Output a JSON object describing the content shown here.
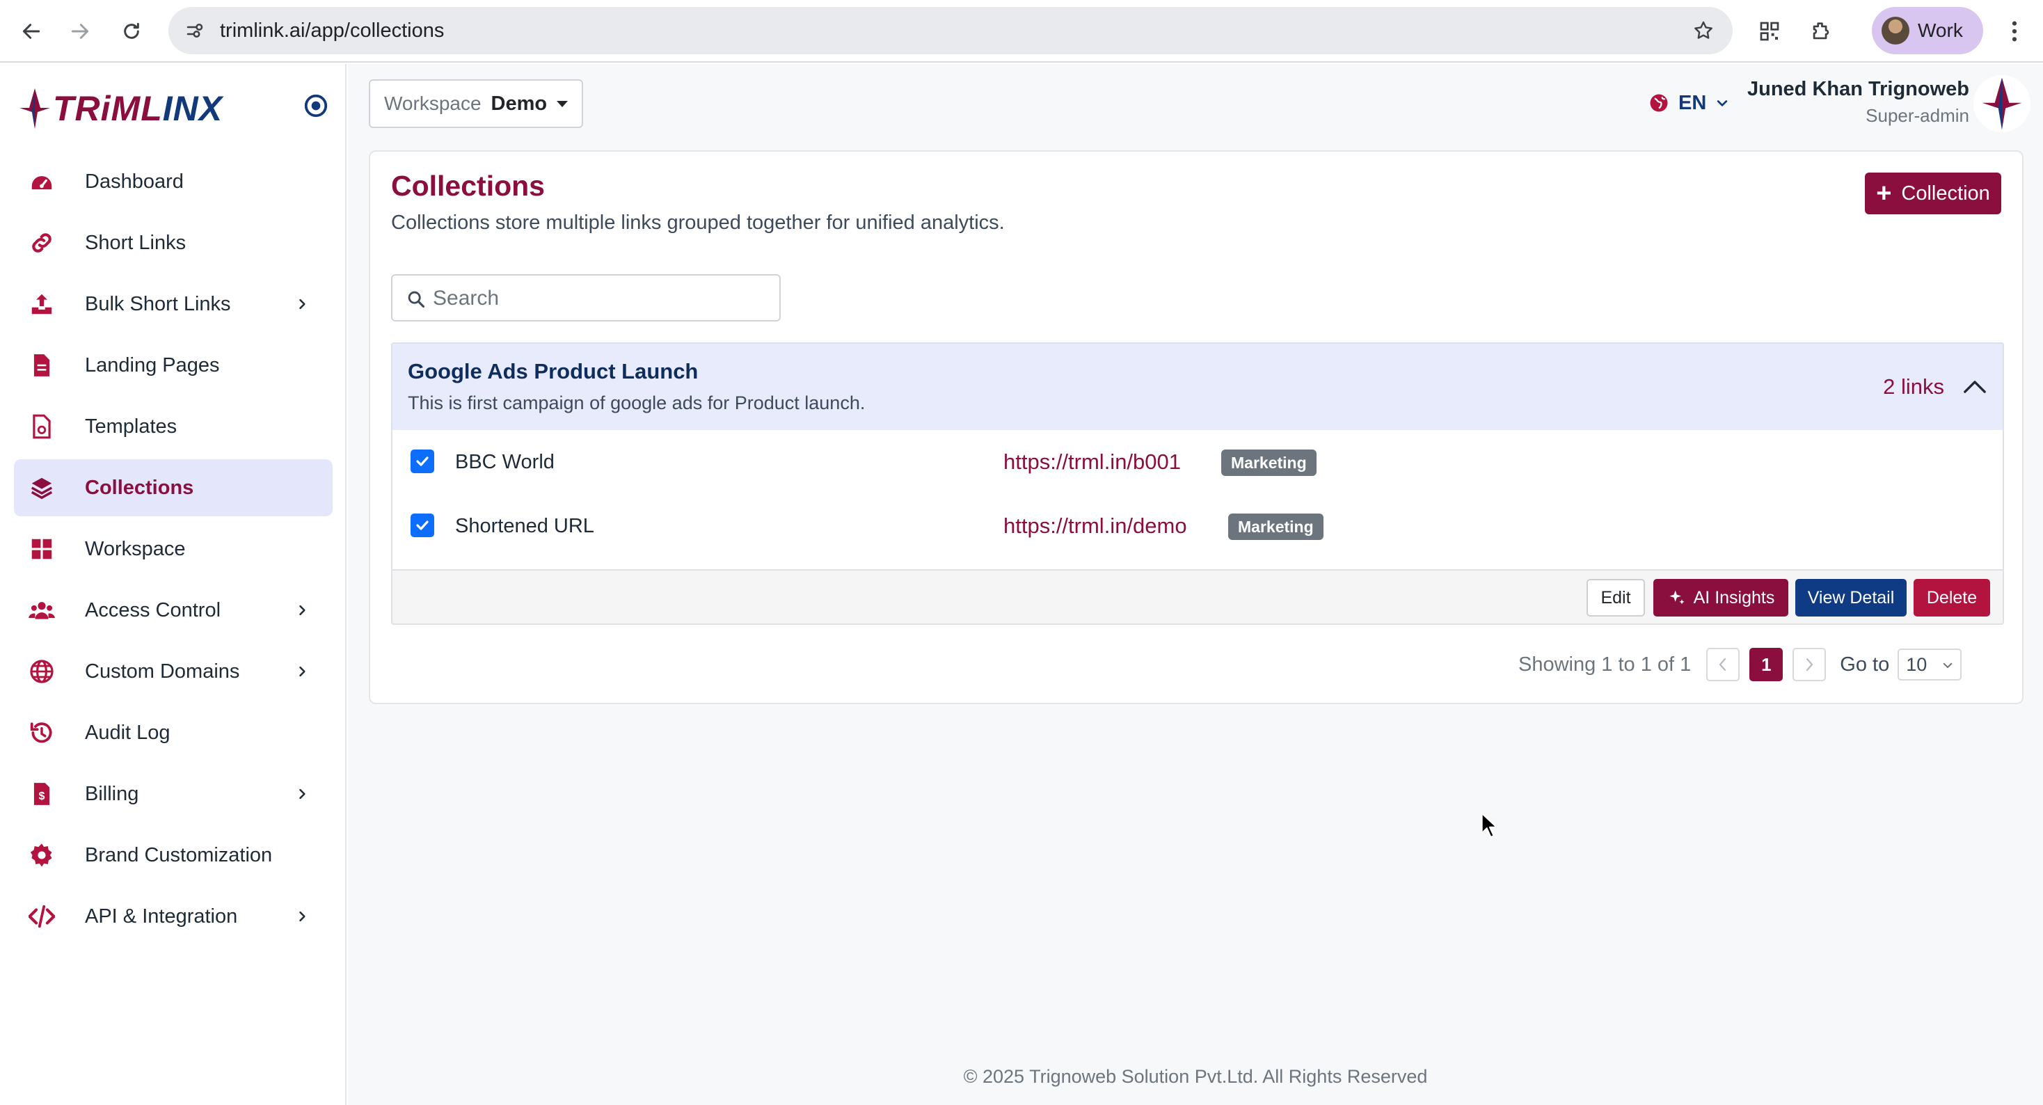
{
  "browser": {
    "url": "trimlink.ai/app/collections",
    "profile_label": "Work"
  },
  "brand": {
    "logo_text_a": "TRiML",
    "logo_text_b": "INX"
  },
  "sidebar": {
    "items": [
      {
        "label": "Dashboard",
        "icon": "dashboard-icon"
      },
      {
        "label": "Short Links",
        "icon": "link-icon"
      },
      {
        "label": "Bulk Short Links",
        "icon": "upload-icon"
      },
      {
        "label": "Landing Pages",
        "icon": "document-icon"
      },
      {
        "label": "Templates",
        "icon": "template-icon"
      },
      {
        "label": "Collections",
        "icon": "layers-icon"
      },
      {
        "label": "Workspace",
        "icon": "grid-icon"
      },
      {
        "label": "Access Control",
        "icon": "users-icon"
      },
      {
        "label": "Custom Domains",
        "icon": "globe-icon"
      },
      {
        "label": "Audit Log",
        "icon": "history-icon"
      },
      {
        "label": "Billing",
        "icon": "invoice-icon"
      },
      {
        "label": "Brand Customization",
        "icon": "gear-icon"
      },
      {
        "label": "API & Integration",
        "icon": "code-icon"
      }
    ],
    "active": "Collections"
  },
  "topbar": {
    "workspace_label": "Workspace",
    "workspace_value": "Demo",
    "language": "EN",
    "user_name": "Juned Khan Trignoweb",
    "user_role": "Super-admin"
  },
  "page": {
    "title": "Collections",
    "subtitle": "Collections store multiple links grouped together for unified analytics.",
    "add_button": "Collection",
    "search_placeholder": "Search"
  },
  "collection": {
    "name": "Google Ads Product Launch",
    "description": "This is first campaign of google ads for Product launch.",
    "link_count": "2 links",
    "links": [
      {
        "name": "BBC World",
        "url": "https://trml.in/b001",
        "tag": "Marketing",
        "checked": true
      },
      {
        "name": "Shortened URL",
        "url": "https://trml.in/demo",
        "tag": "Marketing",
        "checked": true
      }
    ],
    "actions": {
      "edit": "Edit",
      "ai_insights": "AI Insights",
      "view_detail": "View Detail",
      "delete": "Delete"
    }
  },
  "pagination": {
    "summary": "Showing 1 to 1 of 1",
    "current_page": "1",
    "goto_label": "Go to",
    "page_size": "10"
  },
  "footer": {
    "copyright": "© 2025 Trignoweb Solution Pvt.Ltd. All Rights Reserved"
  },
  "colors": {
    "brand_primary": "#8a0f3f",
    "brand_navy": "#0f3a84",
    "active_nav_bg": "#e4e6fb",
    "collection_header_bg": "#e8ebfb",
    "tag_bg": "#6c757d"
  }
}
